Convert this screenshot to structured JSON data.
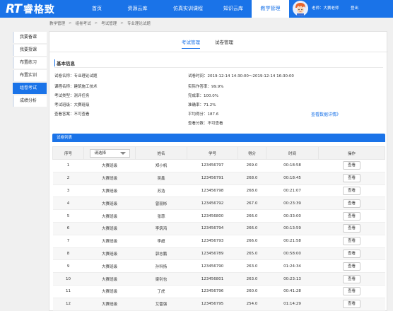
{
  "header": {
    "logo_mark": "RT",
    "logo_text": "睿格致",
    "nav": [
      "首页",
      "资源云库",
      "仿真实训课程",
      "知识云库",
      "教学管理"
    ],
    "active_nav": 4,
    "user_name": "老师：大赛老师",
    "logout": "登出"
  },
  "breadcrumb": [
    "教学管理",
    "组卷考试",
    "考试管理",
    "专业理论试题"
  ],
  "sidebar": [
    "我要备课",
    "我要授课",
    "布置练习",
    "布置实训",
    "组卷考试",
    "成绩分析"
  ],
  "sidebar_active": 4,
  "tabs": [
    "考试管理",
    "试卷管理"
  ],
  "info": {
    "title": "基本信息",
    "left": [
      {
        "k": "试卷名称：",
        "v": "专业理论试题"
      },
      {
        "k": "课程名称：",
        "v": "建筑施工技术"
      },
      {
        "k": "考试类型：",
        "v": "测评任务"
      },
      {
        "k": "考试班级：",
        "v": "大赛班级"
      },
      {
        "k": "查看答案：",
        "v": "不可查看"
      }
    ],
    "right": [
      {
        "k": "试卷时间：",
        "v": "2019-12-14 14:30:00～2019-12-14 16:30:00"
      },
      {
        "k": "实际作答率：",
        "v": "99.9%"
      },
      {
        "k": "完成率：",
        "v": "100.0%"
      },
      {
        "k": "准确率：",
        "v": "71.2%"
      },
      {
        "k": "平均得分：",
        "v": "187.6"
      },
      {
        "k": "查看分数：",
        "v": "不可查看"
      }
    ],
    "detail_link": "查看数据详情》"
  },
  "list": {
    "title": "试卷列表",
    "columns": [
      "序号",
      "请选择",
      "姓名",
      "学号",
      "得分",
      "时间",
      "操作"
    ],
    "view_label": "查看",
    "rows": [
      [
        "1",
        "大赛班级",
        "郑小帆",
        "123456797",
        "269.0",
        "00:18:58"
      ],
      [
        "2",
        "大赛班级",
        "吴鑫",
        "123456791",
        "268.0",
        "00:18:45"
      ],
      [
        "3",
        "大赛班级",
        "苏浩",
        "123456798",
        "268.0",
        "00:21:07"
      ],
      [
        "4",
        "大赛班级",
        "曾丽彬",
        "123456792",
        "267.0",
        "00:23:39"
      ],
      [
        "5",
        "大赛班级",
        "张蒜",
        "123456800",
        "266.0",
        "00:33:00"
      ],
      [
        "6",
        "大赛班级",
        "李筑鸿",
        "123456794",
        "266.0",
        "00:13:59"
      ],
      [
        "7",
        "大赛班级",
        "李超",
        "123456793",
        "266.0",
        "00:21:58"
      ],
      [
        "8",
        "大赛班级",
        "郭志鹏",
        "123456789",
        "265.0",
        "00:58:00"
      ],
      [
        "9",
        "大赛班级",
        "孙科扬",
        "123456790",
        "263.0",
        "01:24:34"
      ],
      [
        "10",
        "大赛班级",
        "梁钊也",
        "123456801",
        "263.0",
        "00:23:13"
      ],
      [
        "11",
        "大赛班级",
        "丁虎",
        "123456796",
        "260.0",
        "00:41:28"
      ],
      [
        "12",
        "大赛班级",
        "艾雷强",
        "123456795",
        "254.0",
        "01:14:29"
      ]
    ]
  },
  "colors": {
    "primary": "#1a73e8"
  }
}
